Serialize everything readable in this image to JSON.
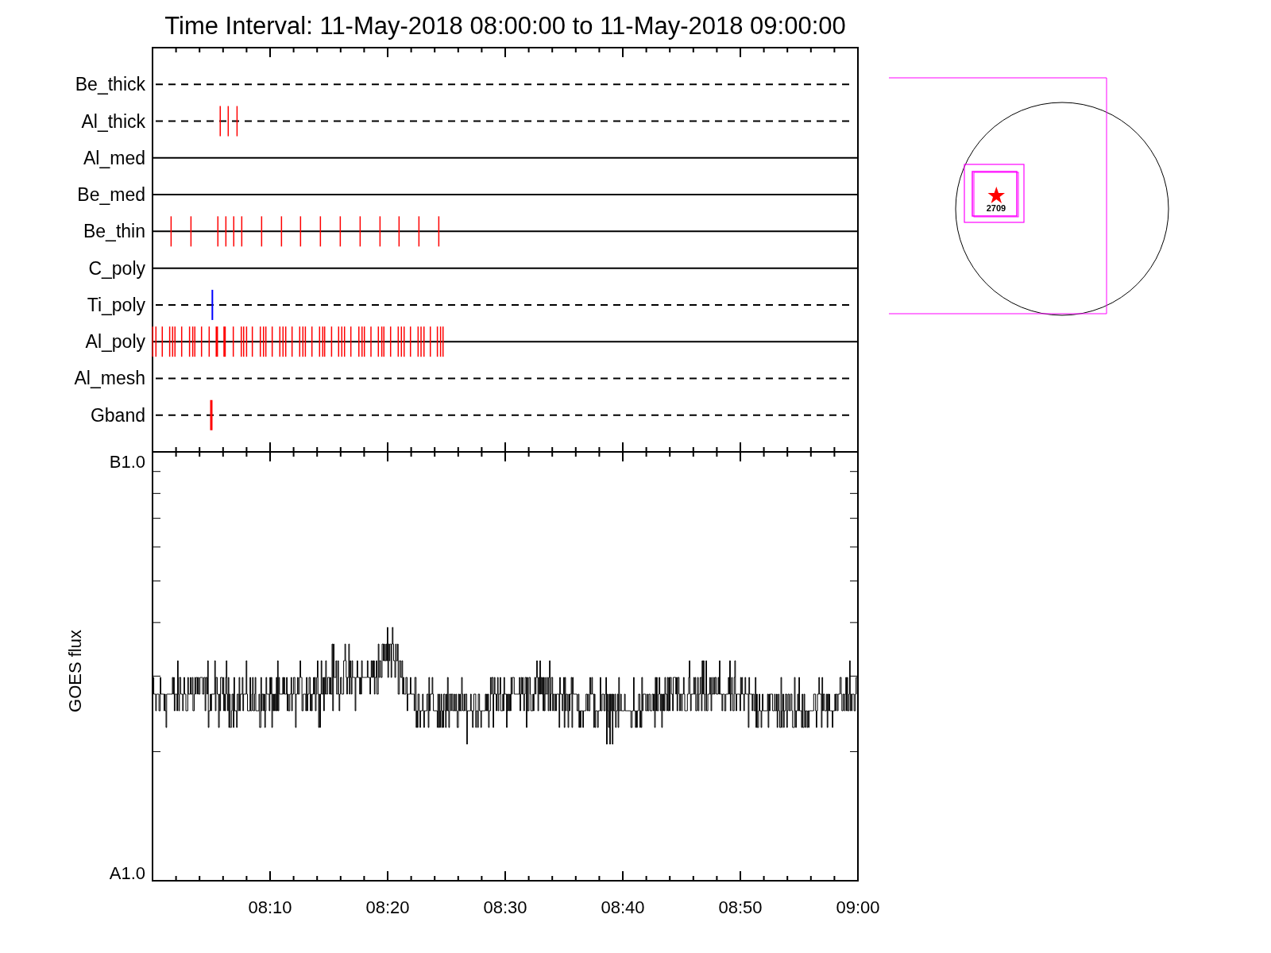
{
  "title": "Time Interval: 11-May-2018 08:00:00 to 11-May-2018 09:00:00",
  "rows": [
    {
      "label": "Be_thick",
      "kind": "dashed"
    },
    {
      "label": "Al_thick",
      "kind": "dashed",
      "color": "#ff0000"
    },
    {
      "label": "Al_med",
      "kind": "solid"
    },
    {
      "label": "Be_med",
      "kind": "solid"
    },
    {
      "label": "Be_thin",
      "kind": "solid",
      "color": "#ff0000"
    },
    {
      "label": "C_poly",
      "kind": "solid"
    },
    {
      "label": "Ti_poly",
      "kind": "dashed",
      "color": "#0000ff"
    },
    {
      "label": "Al_poly",
      "kind": "solid",
      "color": "#ff0000"
    },
    {
      "label": "Al_mesh",
      "kind": "dashed"
    },
    {
      "label": "Gband",
      "kind": "dashed",
      "color": "#ff0000"
    }
  ],
  "goes_panel": {
    "y_axis_label": "GOES flux",
    "y_top_label": "B1.0",
    "y_bottom_label": "A1.0",
    "x_tick_labels": [
      "08:10",
      "08:20",
      "08:30",
      "08:40",
      "08:50",
      "09:00"
    ]
  },
  "context_map": {
    "region_label": "2709"
  }
}
